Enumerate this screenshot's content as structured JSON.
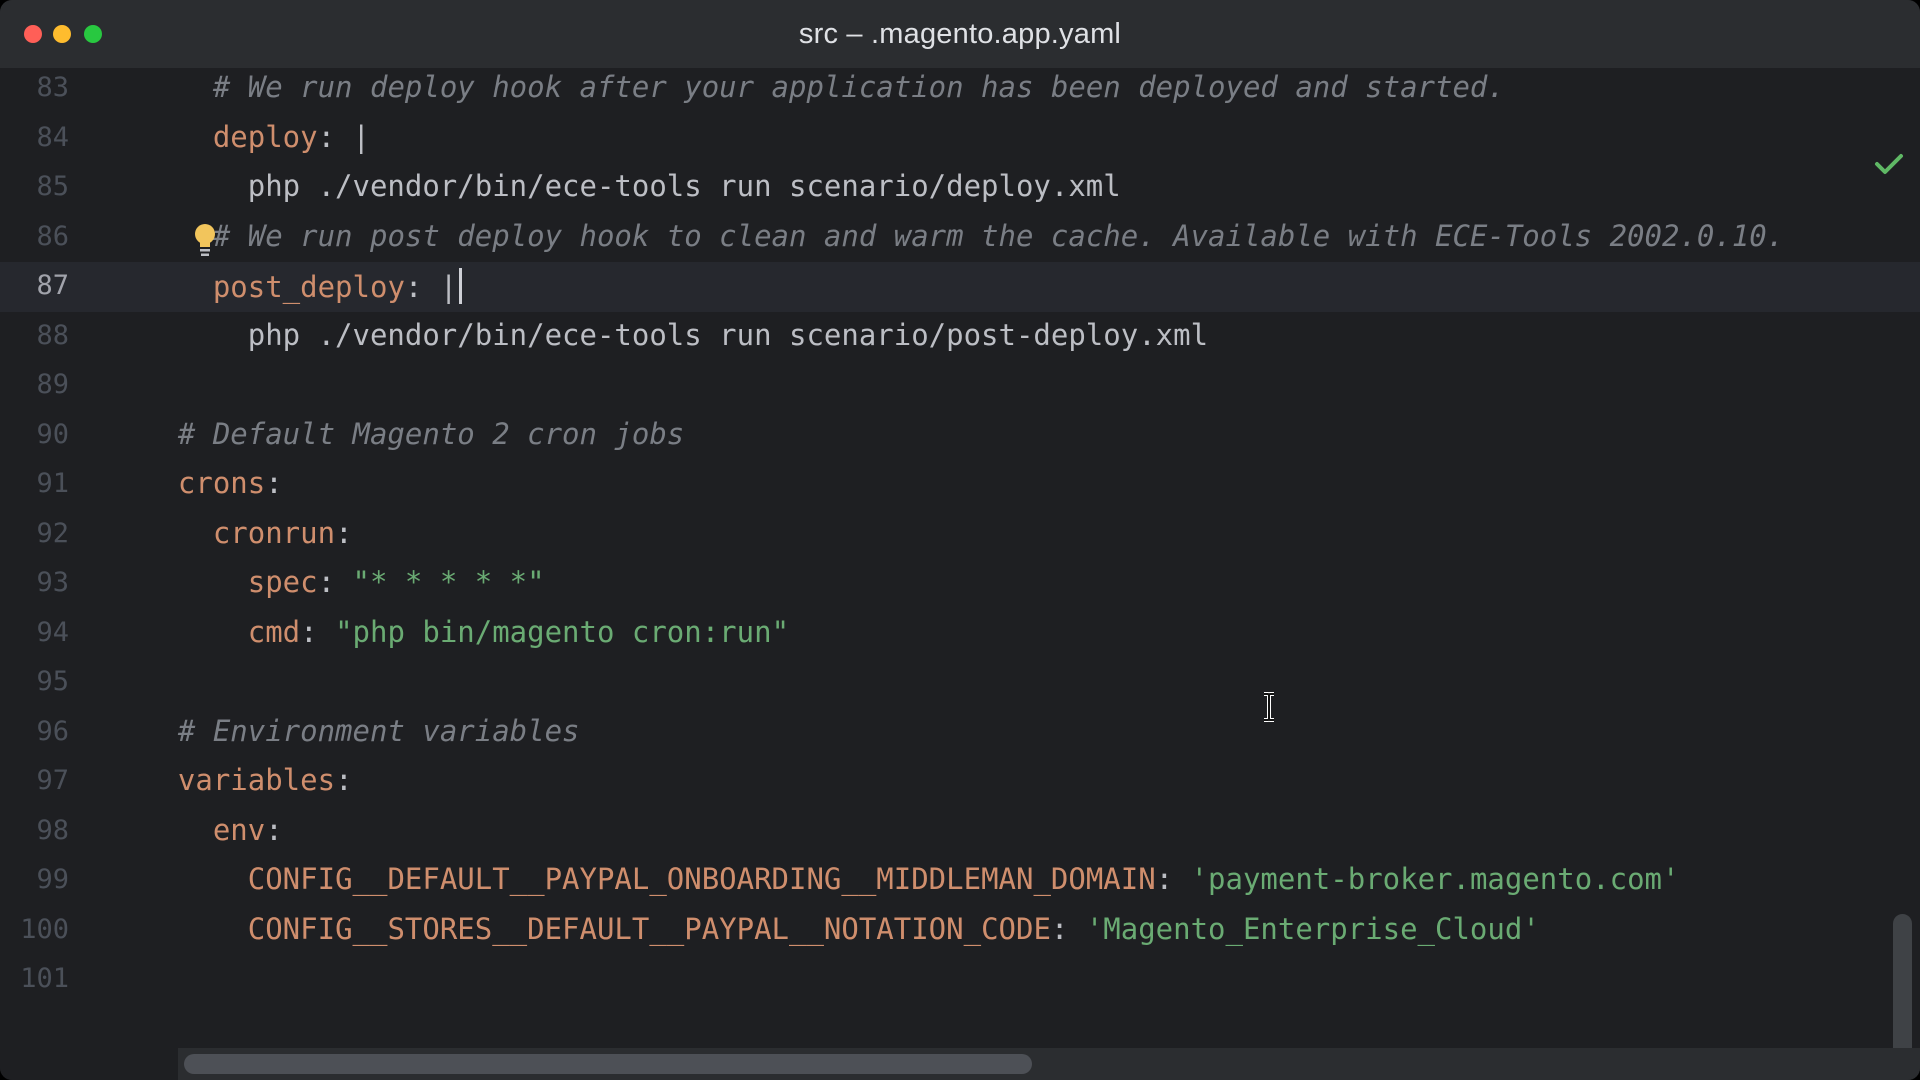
{
  "window": {
    "title": "src – .magento.app.yaml"
  },
  "editor": {
    "current_line": "87",
    "lines": [
      {
        "num": "83",
        "segments": [
          {
            "t": "    ",
            "c": "plain"
          },
          {
            "t": "# We run deploy hook after your application has been deployed and started.",
            "c": "comment"
          }
        ]
      },
      {
        "num": "84",
        "segments": [
          {
            "t": "    ",
            "c": "plain"
          },
          {
            "t": "deploy",
            "c": "key"
          },
          {
            "t": ": |",
            "c": "plain"
          }
        ]
      },
      {
        "num": "85",
        "segments": [
          {
            "t": "      php ./vendor/bin/ece-tools run scenario/deploy.xml",
            "c": "plain"
          }
        ]
      },
      {
        "num": "86",
        "segments": [
          {
            "t": "    ",
            "c": "plain"
          },
          {
            "t": "# We run post deploy hook to clean and warm the cache. Available with ECE-Tools 2002.0.10.",
            "c": "comment"
          }
        ]
      },
      {
        "num": "87",
        "segments": [
          {
            "t": "    ",
            "c": "plain"
          },
          {
            "t": "post_deploy",
            "c": "key"
          },
          {
            "t": ": |",
            "c": "plain"
          }
        ]
      },
      {
        "num": "88",
        "segments": [
          {
            "t": "      php ./vendor/bin/ece-tools run scenario/post-deploy.xml",
            "c": "plain"
          }
        ]
      },
      {
        "num": "89",
        "segments": []
      },
      {
        "num": "90",
        "segments": [
          {
            "t": "  ",
            "c": "plain"
          },
          {
            "t": "# Default Magento 2 cron jobs",
            "c": "comment"
          }
        ]
      },
      {
        "num": "91",
        "segments": [
          {
            "t": "  ",
            "c": "plain"
          },
          {
            "t": "crons",
            "c": "key"
          },
          {
            "t": ":",
            "c": "plain"
          }
        ]
      },
      {
        "num": "92",
        "segments": [
          {
            "t": "    ",
            "c": "plain"
          },
          {
            "t": "cronrun",
            "c": "key"
          },
          {
            "t": ":",
            "c": "plain"
          }
        ]
      },
      {
        "num": "93",
        "segments": [
          {
            "t": "      ",
            "c": "plain"
          },
          {
            "t": "spec",
            "c": "key"
          },
          {
            "t": ": ",
            "c": "plain"
          },
          {
            "t": "\"* * * * *\"",
            "c": "str"
          }
        ]
      },
      {
        "num": "94",
        "segments": [
          {
            "t": "      ",
            "c": "plain"
          },
          {
            "t": "cmd",
            "c": "key"
          },
          {
            "t": ": ",
            "c": "plain"
          },
          {
            "t": "\"php bin/magento cron:run\"",
            "c": "str"
          }
        ]
      },
      {
        "num": "95",
        "segments": []
      },
      {
        "num": "96",
        "segments": [
          {
            "t": "  ",
            "c": "plain"
          },
          {
            "t": "# Environment variables",
            "c": "comment"
          }
        ]
      },
      {
        "num": "97",
        "segments": [
          {
            "t": "  ",
            "c": "plain"
          },
          {
            "t": "variables",
            "c": "key"
          },
          {
            "t": ":",
            "c": "plain"
          }
        ]
      },
      {
        "num": "98",
        "segments": [
          {
            "t": "    ",
            "c": "plain"
          },
          {
            "t": "env",
            "c": "key"
          },
          {
            "t": ":",
            "c": "plain"
          }
        ]
      },
      {
        "num": "99",
        "segments": [
          {
            "t": "      ",
            "c": "plain"
          },
          {
            "t": "CONFIG__DEFAULT__PAYPAL_ONBOARDING__MIDDLEMAN_DOMAIN",
            "c": "key"
          },
          {
            "t": ": ",
            "c": "plain"
          },
          {
            "t": "'payment-broker.magento.com'",
            "c": "str"
          }
        ]
      },
      {
        "num": "100",
        "segments": [
          {
            "t": "      ",
            "c": "plain"
          },
          {
            "t": "CONFIG__STORES__DEFAULT__PAYPAL__NOTATION_CODE",
            "c": "key"
          },
          {
            "t": ": ",
            "c": "plain"
          },
          {
            "t": "'Magento_Enterprise_Cloud'",
            "c": "str"
          }
        ]
      },
      {
        "num": "101",
        "segments": []
      }
    ]
  },
  "icons": {
    "close": "close-traffic-light-icon",
    "minimize": "minimize-traffic-light-icon",
    "maximize": "maximize-traffic-light-icon",
    "intention_bulb": "lightbulb-icon",
    "inspection_status": "checkmark-icon",
    "mouse_cursor": "text-cursor-icon"
  },
  "colors": {
    "background": "#1e1f22",
    "titlebar": "#2b2d30",
    "comment": "#7a7e85",
    "key": "#cf8e6d",
    "string": "#6aab73",
    "plain": "#bcbec4",
    "bulb": "#f2c55c",
    "check": "#5fb865"
  }
}
